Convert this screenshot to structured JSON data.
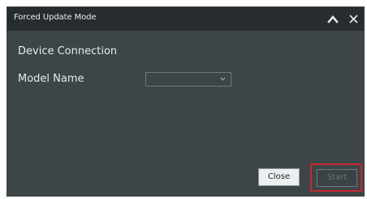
{
  "window": {
    "title": "Forced Update Mode",
    "collapse_icon": "chevron-up-icon",
    "close_icon": "close-icon"
  },
  "content": {
    "section_title": "Device Connection",
    "model_label": "Model Name",
    "model_select": {
      "value": "",
      "icon": "chevron-down-icon"
    }
  },
  "buttons": {
    "close_label": "Close",
    "start_label": "Start",
    "start_enabled": false
  },
  "colors": {
    "dialog_bg": "#3d4547",
    "titlebar_bg": "#272c2e",
    "highlight": "#c8262f"
  }
}
